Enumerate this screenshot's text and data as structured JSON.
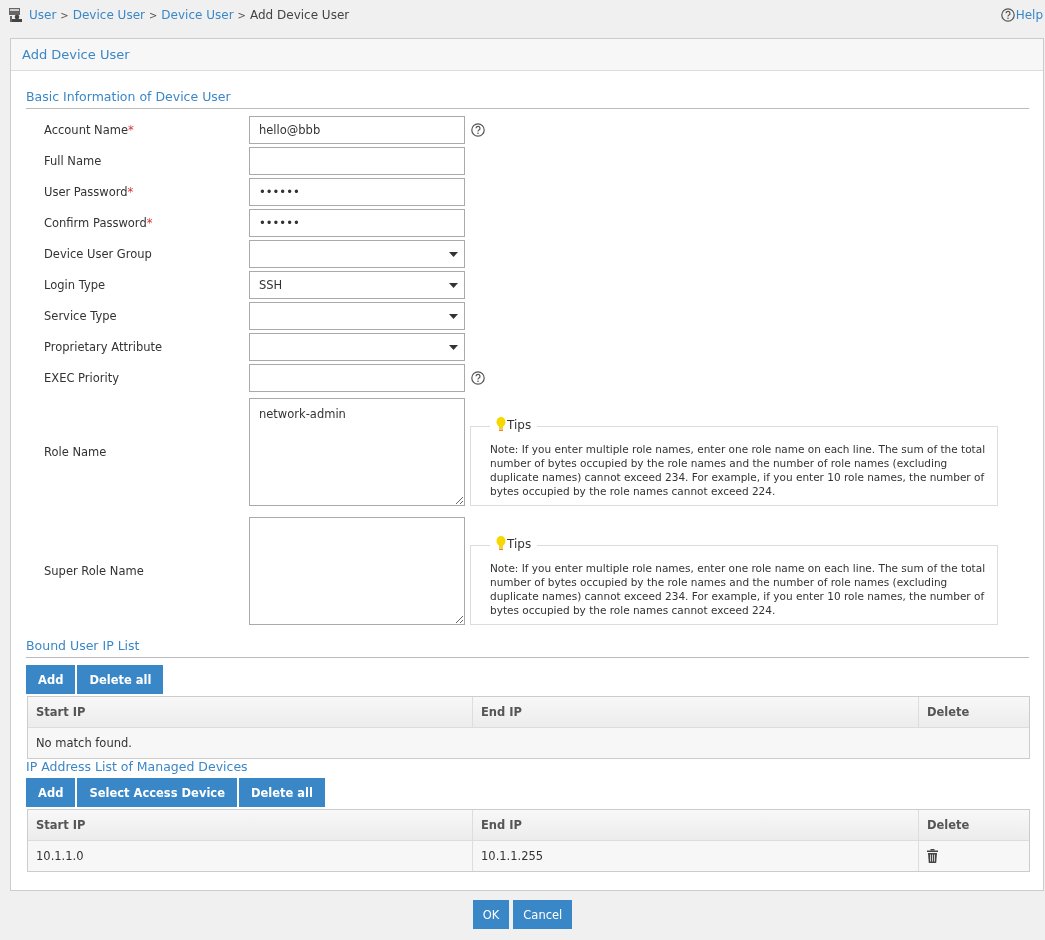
{
  "breadcrumb": [
    {
      "label": "User",
      "link": true
    },
    {
      "label": "Device User",
      "link": true
    },
    {
      "label": "Device User",
      "link": true
    },
    {
      "label": "Add Device User",
      "link": false
    }
  ],
  "separator": ">",
  "required_marker": "*",
  "help": "Help",
  "panel": {
    "title": "Add Device User"
  },
  "basic_section": {
    "title": "Basic Information of Device User",
    "fields": [
      {
        "label": "Account Name",
        "required": true,
        "kind": "text",
        "value": "hello@bbb",
        "help": true
      },
      {
        "label": "Full Name",
        "required": false,
        "kind": "text",
        "help": false
      },
      {
        "label": "User Password",
        "required": true,
        "kind": "text",
        "value": "••••••",
        "help": false
      },
      {
        "label": "Confirm Password",
        "required": true,
        "kind": "text",
        "value": "••••••",
        "help": false
      },
      {
        "label": "Device User Group",
        "required": false,
        "kind": "select",
        "help": false
      },
      {
        "label": "Login Type",
        "required": false,
        "kind": "select",
        "value": "SSH",
        "help": false
      },
      {
        "label": "Service Type",
        "required": false,
        "kind": "select",
        "help": false
      },
      {
        "label": "Proprietary Attribute",
        "required": false,
        "kind": "select",
        "help": false
      },
      {
        "label": "EXEC Priority",
        "required": false,
        "kind": "text",
        "help": true
      },
      {
        "label": "Role Name",
        "required": false,
        "kind": "textarea",
        "value": "network-admin",
        "help": false,
        "tips": {
          "title": "Tips",
          "text": "Note: If you enter multiple role names, enter one role name on each line. The sum of the total number of bytes occupied by the role names and the number of role names (excluding duplicate names) cannot exceed 234. For example, if you enter 10 role names, the number of bytes occupied by the role names cannot exceed 224."
        }
      },
      {
        "label": "Super Role Name",
        "required": false,
        "kind": "textarea",
        "help": false,
        "tips": {
          "title": "Tips",
          "text": "Note: If you enter multiple role names, enter one role name on each line. The sum of the total number of bytes occupied by the role names and the number of role names (excluding duplicate names) cannot exceed 234. For example, if you enter 10 role names, the number of bytes occupied by the role names cannot exceed 224."
        }
      }
    ]
  },
  "lists": [
    {
      "title": "Bound User IP List",
      "underline": true,
      "buttons": [
        "Add",
        "Delete all"
      ],
      "columns": [
        "Start IP",
        "End IP",
        "Delete"
      ],
      "empty_text": "No match found."
    },
    {
      "title": "IP Address List of Managed Devices",
      "underline": false,
      "buttons": [
        "Add",
        "Select Access Device",
        "Delete all"
      ],
      "columns": [
        "Start IP",
        "End IP",
        "Delete"
      ],
      "rows": [
        {
          "start_ip": "10.1.1.0",
          "end_ip": "10.1.1.255"
        }
      ]
    }
  ],
  "footer_buttons": [
    "OK",
    "Cancel"
  ]
}
